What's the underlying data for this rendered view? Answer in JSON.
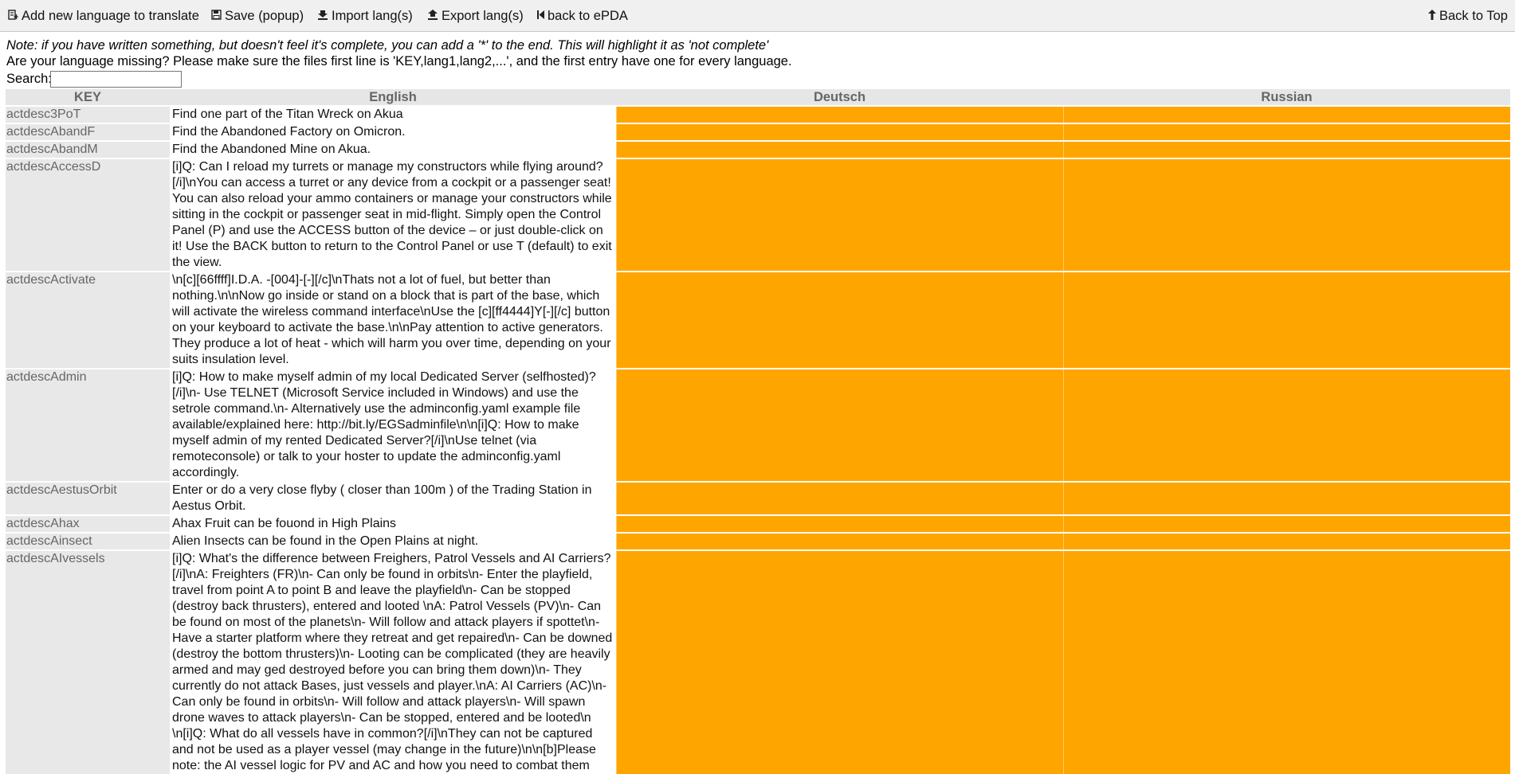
{
  "toolbar": {
    "add_language": {
      "label": "Add new language to translate",
      "icon": "book-add-icon"
    },
    "save": {
      "label": "Save (popup)",
      "icon": "floppy-icon"
    },
    "import": {
      "label": "Import lang(s)",
      "icon": "download-icon"
    },
    "export": {
      "label": "Export lang(s)",
      "icon": "upload-icon"
    },
    "back_epda": {
      "label": "back to ePDA",
      "icon": "skip-back-icon"
    },
    "back_top": {
      "label": "Back to Top",
      "icon": "arrow-up-icon"
    }
  },
  "notes": {
    "line1": "Note: if you have written something, but doesn't feel it's complete, you can add a '*' to the end. This will highlight it as 'not complete'",
    "line2": "Are your language missing? Please make sure the files first line is 'KEY,lang1,lang2,...', and the first entry have one for every language."
  },
  "search": {
    "label": "Search:",
    "value": "",
    "placeholder": ""
  },
  "colors": {
    "missing_translation": "#ffa500",
    "key_bg": "#e8e8e8",
    "header_bg": "#e6e6e6",
    "toolbar_bg": "#f0f0f0"
  },
  "table": {
    "headers": [
      "KEY",
      "English",
      "Deutsch",
      "Russian"
    ],
    "rows": [
      {
        "key": "actdesc3PoT",
        "english": "Find one part of the Titan Wreck on Akua",
        "deutsch": "",
        "russian": ""
      },
      {
        "key": "actdescAbandF",
        "english": "Find the Abandoned Factory on Omicron.",
        "deutsch": "",
        "russian": ""
      },
      {
        "key": "actdescAbandM",
        "english": "Find the Abandoned Mine on Akua.",
        "deutsch": "",
        "russian": ""
      },
      {
        "key": "actdescAccessD",
        "english": "[i]Q: Can I reload my turrets or manage my constructors while flying around?[/i]\\nYou can access a turret or any device from a cockpit or a passenger seat! You can also reload your ammo containers or manage your constructors while sitting in the cockpit or passenger seat in mid-flight. Simply open the Control Panel (P) and use the ACCESS button of the device – or just double-click on it! Use the BACK button to return to the Control Panel or use T (default) to exit the view.",
        "deutsch": "",
        "russian": ""
      },
      {
        "key": "actdescActivate",
        "english": "\\n[c][66ffff]I.D.A. -[004]-[-][/c]\\nThats not a lot of fuel, but better than nothing.\\n\\nNow go inside or stand on a block that is part of the base, which will activate the wireless command interface\\nUse the [c][ff4444]Y[-][/c] button on your keyboard to activate the base.\\n\\nPay attention to active generators. They produce a lot of heat - which will harm you over time, depending on your suits insulation level.",
        "deutsch": "",
        "russian": ""
      },
      {
        "key": "actdescAdmin",
        "english": "[i]Q: How to make myself admin of my local Dedicated Server (selfhosted)?[/i]\\n- Use TELNET (Microsoft Service included in Windows) and use the setrole command.\\n- Alternatively use the adminconfig.yaml example file available/explained here: http://bit.ly/EGSadminfile\\n\\n[i]Q: How to make myself admin of my rented Dedicated Server?[/i]\\nUse telnet (via remoteconsole) or talk to your hoster to update the adminconfig.yaml accordingly.",
        "deutsch": "",
        "russian": ""
      },
      {
        "key": "actdescAestusOrbit",
        "english": "Enter or do a very close flyby ( closer than 100m ) of the Trading Station in Aestus Orbit.",
        "deutsch": "",
        "russian": ""
      },
      {
        "key": "actdescAhax",
        "english": "Ahax Fruit can be fouond in High Plains",
        "deutsch": "",
        "russian": ""
      },
      {
        "key": "actdescAinsect",
        "english": "Alien Insects can be found in the Open Plains at night.",
        "deutsch": "",
        "russian": ""
      },
      {
        "key": "actdescAIvessels",
        "english": "[i]Q: What's the difference between Freighers, Patrol Vessels and AI Carriers?[/i]\\nA: Freighters (FR)\\n- Can only be found in orbits\\n- Enter the playfield, travel from point A to point B and leave the playfield\\n- Can be stopped (destroy back thrusters), entered and looted \\nA: Patrol Vessels (PV)\\n- Can be found on most of the planets\\n- Will follow and attack players if spottet\\n- Have a starter platform where they retreat and get repaired\\n- Can be downed (destroy the bottom thrusters)\\n- Looting can be complicated (they are heavily armed and may ged destroyed before you can bring them down)\\n- They currently do not attack Bases, just vessels and player.\\nA: AI Carriers (AC)\\n- Can only be found in orbits\\n- Will follow and attack players\\n- Will spawn drone waves to attack players\\n- Can be stopped, entered and be looted\\n \\n[i]Q: What do all vessels have in common?[/i]\\nThey can not be captured and not be used as a player vessel (may change in the future)\\n\\n[b]Please note: the AI vessel logic for PV and AC and how you need to combat them",
        "deutsch": "",
        "russian": ""
      }
    ]
  }
}
